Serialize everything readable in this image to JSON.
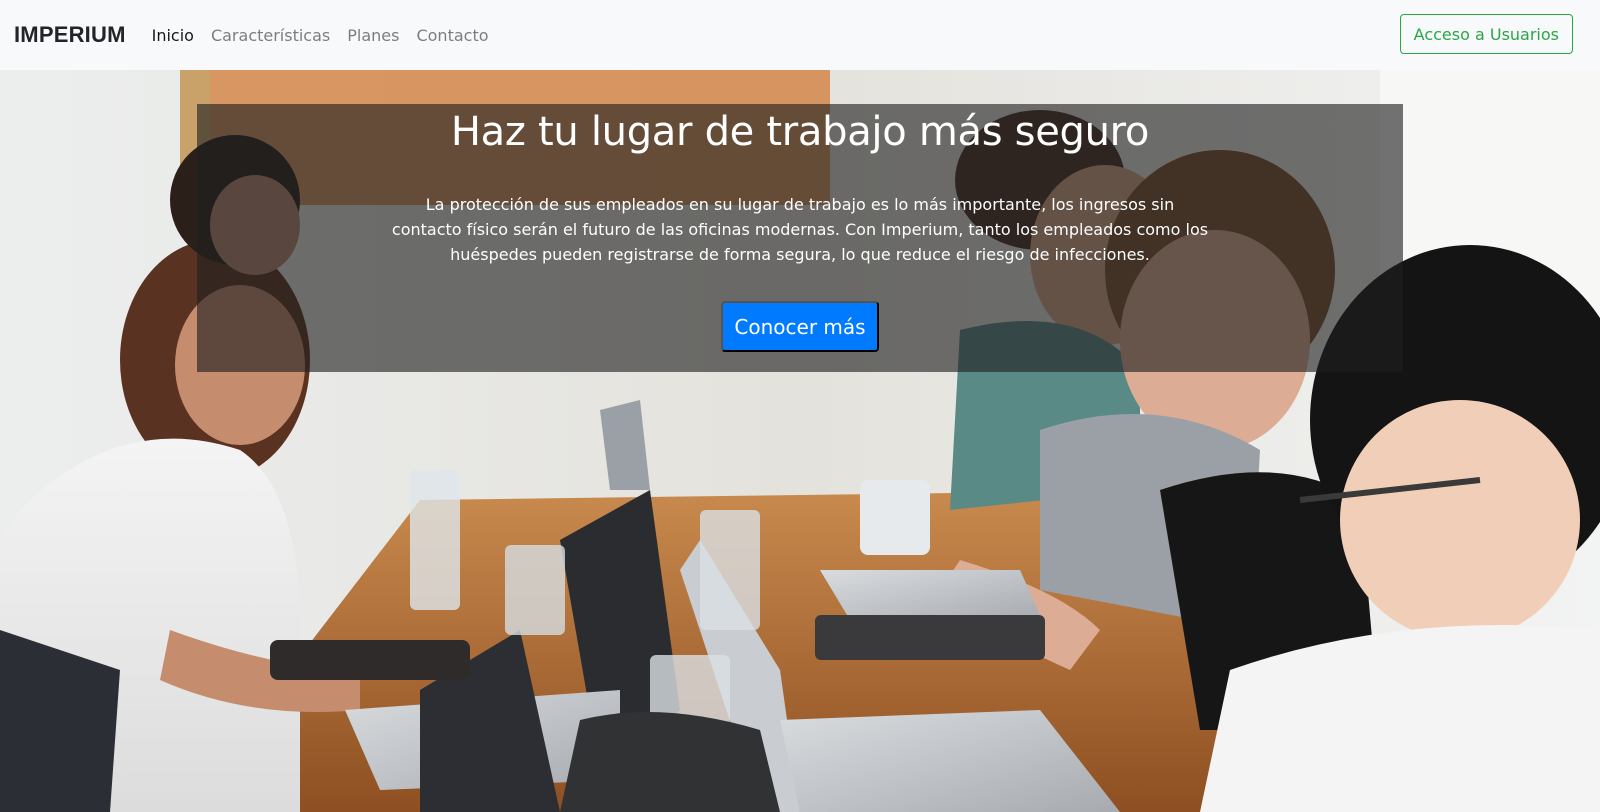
{
  "navbar": {
    "brand": "IMPERIUM",
    "links": [
      {
        "label": "Inicio",
        "active": true
      },
      {
        "label": "Características",
        "active": false
      },
      {
        "label": "Planes",
        "active": false
      },
      {
        "label": "Contacto",
        "active": false
      }
    ],
    "login_label": "Acceso a Usuarios"
  },
  "hero": {
    "title": "Haz tu lugar de trabajo más seguro",
    "text": "La protección de sus empleados en su lugar de trabajo es lo más importante, los ingresos sin contacto físico serán el futuro de las oficinas modernas. Con Imperium, tanto los empleados como los huéspedes pueden registrarse de forma segura, lo que reduce el riesgo de infecciones.",
    "cta_label": "Conocer más"
  },
  "colors": {
    "navbar_bg": "#f8f9fa",
    "login_green": "#28a745",
    "cta_blue": "#007bff",
    "overlay": "rgba(30,30,30,0.62)"
  }
}
